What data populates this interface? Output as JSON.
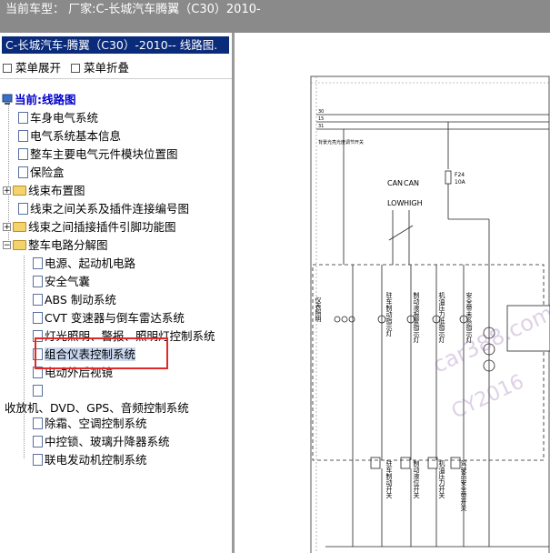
{
  "header": {
    "text": "当前车型： 厂家:C-长城汽车腾翼（C30）2010-"
  },
  "sidebar": {
    "title": "C-长城汽车-腾翼（C30）-2010-- 线路图.",
    "expand_label": "菜单展开",
    "collapse_label": "菜单折叠",
    "current_label": "当前:线路图",
    "items": [
      {
        "label": "车身电气系统"
      },
      {
        "label": "电气系统基本信息"
      },
      {
        "label": "整车主要电气元件模块位置图"
      },
      {
        "label": "保险盒"
      },
      {
        "label": "线束布置图"
      },
      {
        "label": "线束之间关系及插件连接编号图"
      },
      {
        "label": "线束之间插接插件引脚功能图"
      },
      {
        "label": "整车电路分解图"
      }
    ],
    "subitems": [
      {
        "label": "电源、起动机电路"
      },
      {
        "label": "安全气囊"
      },
      {
        "label": "ABS 制动系统"
      },
      {
        "label": "CVT 变速器与倒车雷达系统"
      },
      {
        "label": "灯光照明、警报、照明灯控制系统"
      },
      {
        "label": "组合仪表控制系统"
      },
      {
        "label": "电动外后视镜"
      },
      {
        "label": "收放机、DVD、GPS、音频控制系统"
      },
      {
        "label": "除霜、空调控制系统"
      },
      {
        "label": "中控锁、玻璃升降器系统"
      },
      {
        "label": "联电发动机控制系统"
      }
    ]
  },
  "diagram": {
    "labels": {
      "t30": "30",
      "t15": "15",
      "t31": "31",
      "bg_light": "背景光亮光度调节开关",
      "fuse": "F24",
      "fuse_amp": "10A",
      "can1": "CAN",
      "can2": "CAN",
      "low": "LOW",
      "high": "HIGH",
      "c1": "仪表照明",
      "c2": "驻车制动指示灯",
      "c3": "制动液报警指示灯",
      "c4": "机油压力低指示灯",
      "c5": "安全带未系指示灯",
      "b1": "驻车制动开关",
      "b2": "制动液位开关",
      "b3": "机油压力开关",
      "b4": "驾驶员安全带开关",
      "wm1": "car388.com",
      "wm2": "CY2016"
    }
  }
}
